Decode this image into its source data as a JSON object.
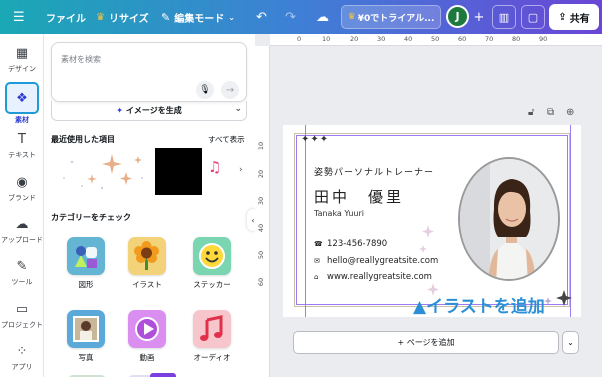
{
  "topbar": {
    "menu_icon": "hamburger-icon",
    "file_label": "ファイル",
    "resize_label": "リサイズ",
    "edit_mode_label": "編集モード",
    "trial_label": "¥0でトライアル...",
    "avatar_initial": "J",
    "share_label": "共有"
  },
  "rail": {
    "items": [
      {
        "label": "デザイン",
        "icon": "layout-icon"
      },
      {
        "label": "素材",
        "icon": "elements-icon"
      },
      {
        "label": "テキスト",
        "icon": "text-icon"
      },
      {
        "label": "ブランド",
        "icon": "brand-icon"
      },
      {
        "label": "アップロード",
        "icon": "upload-icon"
      },
      {
        "label": "ツール",
        "icon": "draw-icon"
      },
      {
        "label": "プロジェクト",
        "icon": "folder-icon"
      },
      {
        "label": "アプリ",
        "icon": "apps-icon"
      }
    ]
  },
  "panel": {
    "search_placeholder": "素材を検索",
    "generate_label": "イメージを生成",
    "recent_title": "最近使用した項目",
    "show_all": "すべて表示",
    "category_title": "カテゴリーをチェック",
    "categories": [
      {
        "label": "図形"
      },
      {
        "label": "イラスト"
      },
      {
        "label": "ステッカー"
      },
      {
        "label": "写真"
      },
      {
        "label": "動画"
      },
      {
        "label": "オーディオ"
      }
    ]
  },
  "ruler": {
    "top": [
      "0",
      "10",
      "20",
      "30",
      "40",
      "50",
      "60",
      "70",
      "80",
      "90"
    ],
    "left": [
      "10",
      "20",
      "30",
      "40",
      "50",
      "60"
    ]
  },
  "card": {
    "role": "姿勢パーソナルトレーナー",
    "name": "田中　優里",
    "romaji": "Tanaka Yuuri",
    "phone": "123-456-7890",
    "email": "hello@reallygreatsite.com",
    "website": "www.reallygreatsite.com"
  },
  "caption": "▲イラストを追加",
  "add_page_label": "+ ページを追加",
  "colors": {
    "accent": "#2c3cd1",
    "active_outline": "#1e9bd7",
    "caption": "#2a8fd6",
    "frame": "#9c7cf0"
  }
}
